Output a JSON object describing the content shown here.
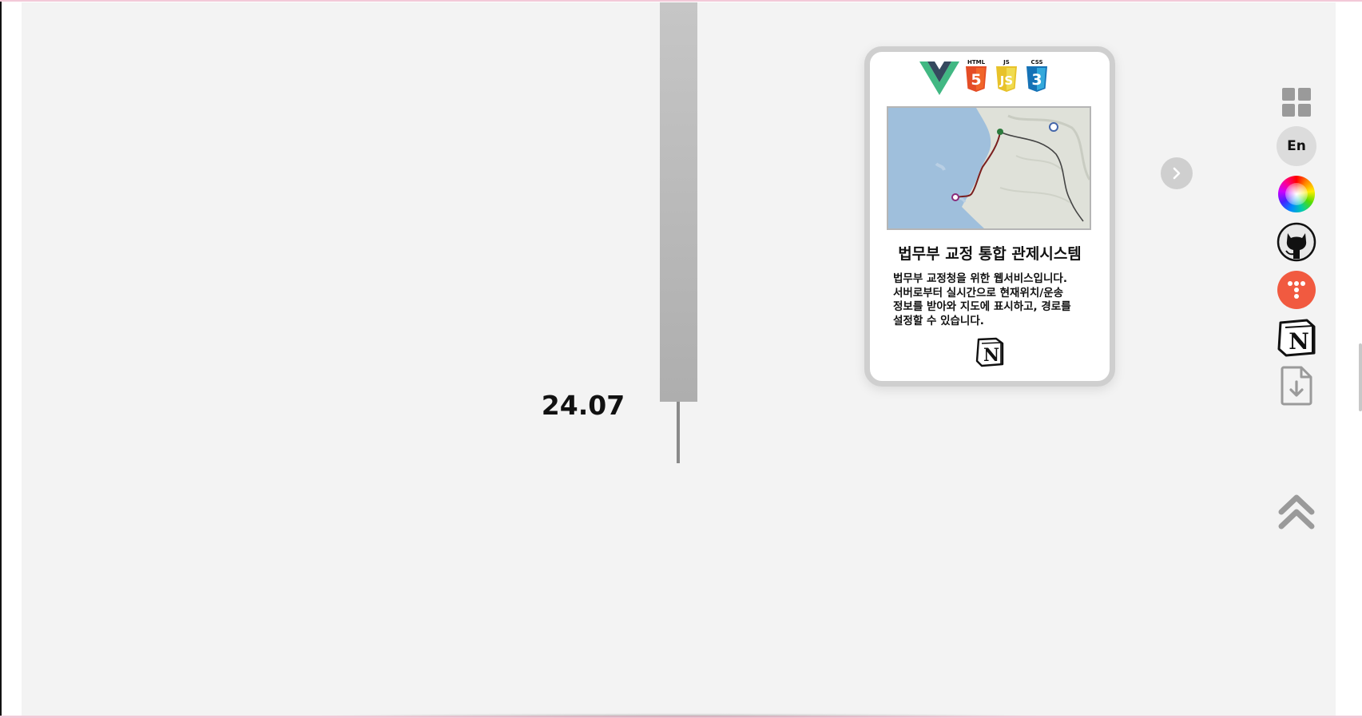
{
  "timeline": {
    "date": "24.07"
  },
  "project": {
    "tech_stack": [
      "vue-icon",
      "html5-icon",
      "javascript-icon",
      "css3-icon"
    ],
    "tech_labels": {
      "html": "HTML",
      "js": "JS",
      "css": "CSS"
    },
    "title": "법무부 교정 통합 관제시스템",
    "description_lines": [
      "법무부 교정청을 위한 웹서비스입니다.",
      "서버로부터 실시간으로 현재위치/운송",
      "정보를 받아와 지도에 표시하고, 경로를",
      "설정할 수 있습니다."
    ],
    "notion_icon": "notion-icon"
  },
  "sidebar": {
    "items": [
      {
        "name": "grid-menu-icon"
      },
      {
        "name": "language-toggle",
        "label": "En"
      },
      {
        "name": "color-wheel-icon"
      },
      {
        "name": "github-icon"
      },
      {
        "name": "tistory-icon"
      },
      {
        "name": "notion-icon"
      },
      {
        "name": "file-download-icon"
      }
    ],
    "scroll_top_icon": "double-chevron-up-icon"
  },
  "colors": {
    "background": "#f3f3f3",
    "vue_green": "#41b883",
    "vue_dark": "#35495e",
    "html_orange": "#e44d26",
    "js_yellow": "#f0db4f",
    "css_blue": "#1572b6",
    "tistory_red": "#f15a40",
    "icon_gray": "#9a9a9a"
  }
}
